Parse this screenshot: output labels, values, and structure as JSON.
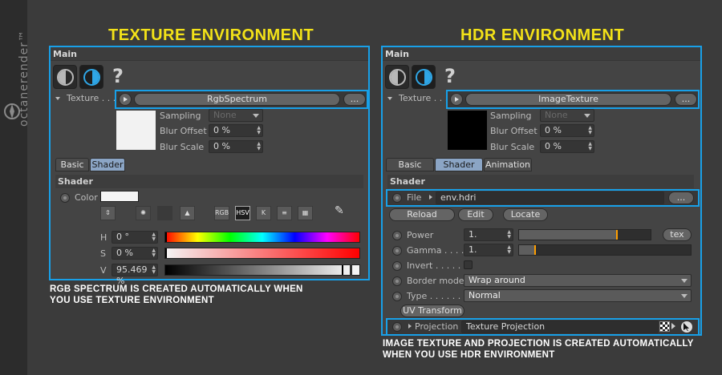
{
  "brand": {
    "text": "octanerender™"
  },
  "left": {
    "title": "TEXTURE ENVIRONMENT",
    "caption_line1": "RGB SPECTRUM IS CREATED AUTOMATICALLY WHEN",
    "caption_line2": "YOU USE TEXTURE ENVIRONMENT",
    "main_label": "Main",
    "texture_label": "Texture . . .",
    "texture_value": "RgbSpectrum",
    "ellipsis": "...",
    "preview_color": "#f2f2f2",
    "sampling_label": "Sampling",
    "sampling_value": "None",
    "blur_offset_label": "Blur Offset",
    "blur_offset_value": "0 %",
    "blur_scale_label": "Blur Scale",
    "blur_scale_value": "0 %",
    "tabs": [
      "Basic",
      "Shader"
    ],
    "shader_label": "Shader",
    "color_label": "Color",
    "swatch_color": "#f4f4f4",
    "tools": [
      "RGB",
      "HSV",
      "K"
    ],
    "h_label": "H",
    "h_value": "0 °",
    "s_label": "S",
    "s_value": "0 %",
    "v_label": "V",
    "v_value": "95.469 %",
    "hsv_level": {
      "h": 0,
      "s": 0,
      "v": 0.95469
    }
  },
  "right": {
    "title": "HDR ENVIRONMENT",
    "caption_line1": "IMAGE TEXTURE AND PROJECTION IS CREATED AUTOMATICALLY",
    "caption_line2": "WHEN YOU USE HDR ENVIRONMENT",
    "main_label": "Main",
    "texture_label": "Texture . . .",
    "texture_value": "ImageTexture",
    "ellipsis": "...",
    "preview_color": "#000000",
    "sampling_label": "Sampling",
    "sampling_value": "None",
    "blur_offset_label": "Blur Offset",
    "blur_offset_value": "0 %",
    "blur_scale_label": "Blur Scale",
    "blur_scale_value": "0 %",
    "tabs": [
      "Basic",
      "Shader",
      "Animation"
    ],
    "shader_label": "Shader",
    "file_label": "File",
    "file_value": "env.hdri",
    "reload_label": "Reload",
    "edit_label": "Edit",
    "locate_label": "Locate",
    "power_label": "Power",
    "power_value": "1.",
    "power_level": 0.75,
    "tex_label": "tex",
    "gamma_label": "Gamma . . . . .",
    "gamma_value": "1.",
    "gamma_level": 0.1,
    "invert_label": "Invert . . . . . .",
    "border_mode_label": "Border mode",
    "border_mode_value": "Wrap around",
    "type_label": "Type . . . . . .",
    "type_value": "Normal",
    "uv_transform_label": "UV Transform",
    "projection_label": "Projection",
    "projection_value": "Texture Projection"
  }
}
